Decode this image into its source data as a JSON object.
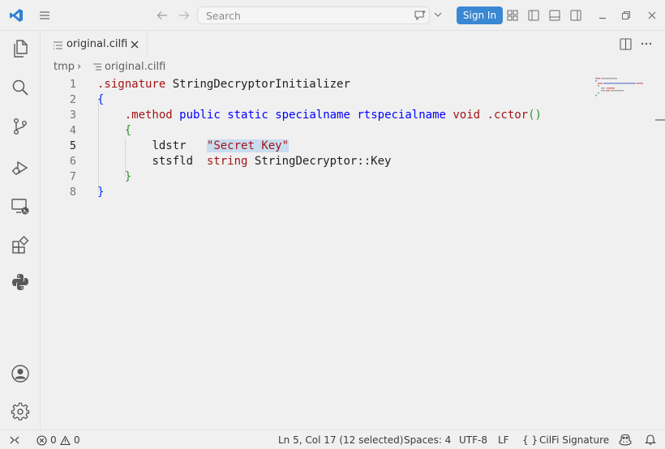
{
  "titlebar": {
    "search_placeholder": "Search",
    "sign_in_label": "Sign In"
  },
  "tab": {
    "label": "original.cilfi"
  },
  "breadcrumb": {
    "folder": "tmp",
    "separator": "›",
    "file": "original.cilfi"
  },
  "editor": {
    "line_numbers": [
      "1",
      "2",
      "3",
      "4",
      "5",
      "6",
      "7",
      "8"
    ],
    "active_line": "5",
    "lines": [
      {
        "dot": ".signature",
        "rest": " StringDecryptorInitializer"
      },
      {
        "brace": "{"
      },
      {
        "m_dot": ".method",
        "m_public": "public",
        "m_static": "static",
        "m_special": "specialname",
        "m_rtspecial": "rtspecialname",
        "m_void": "void",
        "m_cctor": ".cctor",
        "m_parens": "()"
      },
      {
        "brace": "{"
      },
      {
        "op": "ldstr",
        "arg": "\"Secret Key\""
      },
      {
        "op": "stsfld",
        "type": "string",
        "field": "StringDecryptor::Key"
      },
      {
        "brace": "}"
      },
      {
        "brace": "}"
      }
    ]
  },
  "statusbar": {
    "errors": "0",
    "warnings": "0",
    "position": "Ln 5, Col 17 (12 selected)",
    "spaces": "Spaces: 4",
    "encoding": "UTF-8",
    "eol": "LF",
    "language_braces": "{ }",
    "language": "CilFi Signature"
  },
  "colors": {
    "accent": "#3a88d3",
    "keyword_red": "#a31515",
    "keyword_blue": "#0000ff",
    "selection": "#c8dcef"
  }
}
